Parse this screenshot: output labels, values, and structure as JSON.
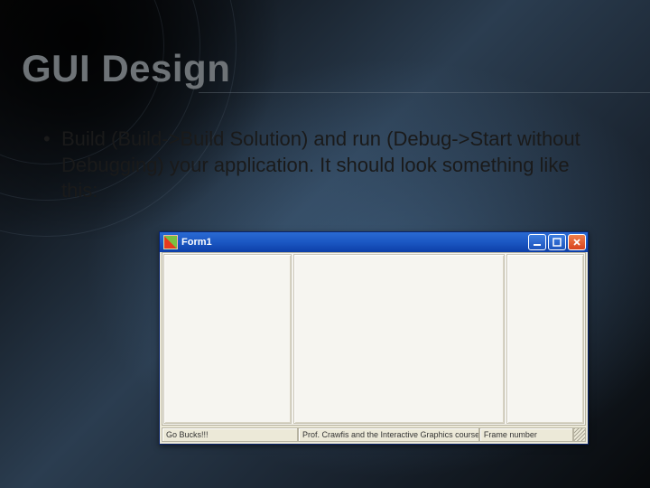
{
  "slide": {
    "title": "GUI Design",
    "bullet": "Build (Build->Build Solution) and run (Debug->Start without Debugging) your application. It should look something like this:"
  },
  "form": {
    "title": "Form1",
    "status": {
      "left": "Go Bucks!!!",
      "middle": "Prof. Crawfis and the Interactive Graphics course rocks",
      "right": "Frame number"
    }
  }
}
